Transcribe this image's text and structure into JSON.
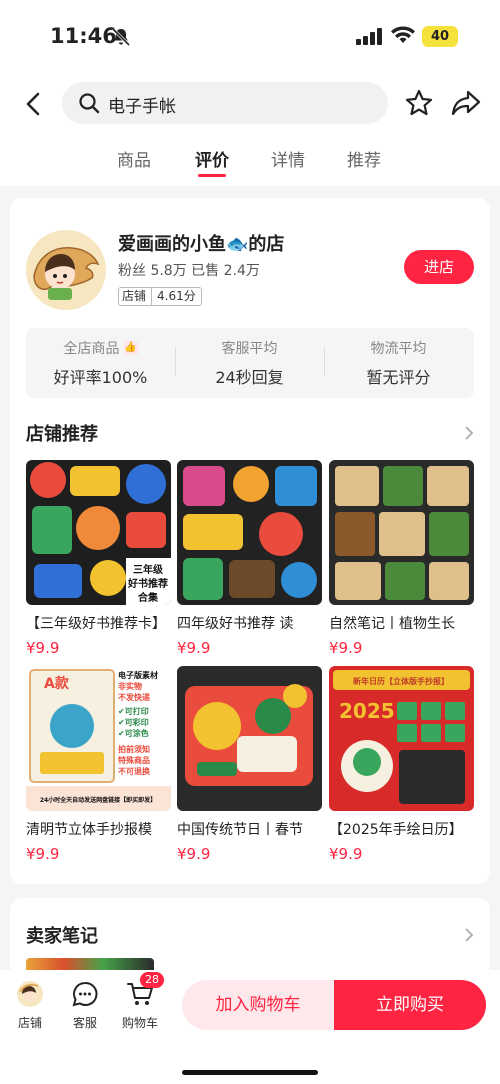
{
  "status": {
    "time": "11:46",
    "battery": "40"
  },
  "search": {
    "query": "电子手帐"
  },
  "tabs": [
    {
      "label": "商品"
    },
    {
      "label": "评价"
    },
    {
      "label": "详情"
    },
    {
      "label": "推荐"
    }
  ],
  "shop": {
    "name": "爱画画的小鱼🐟的店",
    "stats": "粉丝 5.8万  已售 2.4万",
    "badge_label": "店铺",
    "badge_score": "4.61分",
    "enter_label": "进店"
  },
  "ratings": [
    {
      "label": "全店商品",
      "value": "好评率100%",
      "icon": "thumb-icon"
    },
    {
      "label": "客服平均",
      "value": "24秒回复"
    },
    {
      "label": "物流平均",
      "value": "暂无评分"
    }
  ],
  "recommend": {
    "title": "店铺推荐",
    "products": [
      {
        "title": "【三年级好书推荐卡】",
        "price": "¥9.9",
        "overlay": "三年级\n好书推荐\n合集",
        "colors": [
          "#e94b3c",
          "#2f6fd6",
          "#f2c230",
          "#3aa55c"
        ]
      },
      {
        "title": "四年级好书推荐 读",
        "price": "¥9.9",
        "overlay": "",
        "colors": [
          "#d84a8a",
          "#2f8fd6",
          "#f2a230",
          "#6b4a2a"
        ]
      },
      {
        "title": "自然笔记丨植物生长",
        "price": "¥9.9",
        "overlay": "",
        "colors": [
          "#4a8a3a",
          "#e0c08a",
          "#8a5a2a",
          "#2a2a2a"
        ]
      },
      {
        "title": "清明节立体手抄报模",
        "price": "¥9.9",
        "overlay": "A款",
        "colors": [
          "#f5f0e0",
          "#3aa5c8",
          "#e94b3c",
          "#2a2a2a"
        ]
      },
      {
        "title": "中国传统节日丨春节",
        "price": "¥9.9",
        "overlay": "",
        "colors": [
          "#e94b3c",
          "#f2c230",
          "#2a8a4a",
          "#2a2a2a"
        ]
      },
      {
        "title": "【2025年手绘日历】",
        "price": "¥9.9",
        "overlay": "2025",
        "colors": [
          "#d92a2a",
          "#3aa55c",
          "#f5f0e0",
          "#2a2a2a"
        ]
      }
    ],
    "product4_side": {
      "lines": [
        "电子版素材",
        "非实物",
        "不发快递",
        "✔可打印",
        "✔可彩印",
        "✔可涂色",
        "拍前须知",
        "特殊商品",
        "不可退换"
      ],
      "footer": "24小时全天自动发送网盘链接【即买即发】"
    },
    "product6_banner": "新年日历【立体版手抄报】"
  },
  "notes": {
    "title": "卖家笔记"
  },
  "bottom": {
    "shop_label": "店铺",
    "service_label": "客服",
    "cart_label": "购物车",
    "cart_count": "28",
    "add_cart": "加入购物车",
    "buy_now": "立即购买"
  }
}
